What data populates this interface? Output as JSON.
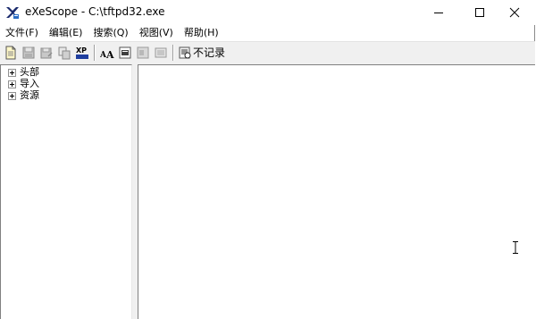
{
  "window": {
    "title": "eXeScope - C:\\tftpd32.exe"
  },
  "menu": [
    {
      "label": "文件(F)"
    },
    {
      "label": "编辑(E)"
    },
    {
      "label": "搜索(Q)"
    },
    {
      "label": "视图(V)"
    },
    {
      "label": "帮助(H)"
    }
  ],
  "toolbar": {
    "no_record_label": "不记录",
    "icons": [
      "new-file-icon",
      "save-icon",
      "save-as-icon",
      "copy-icon",
      "xp-style-icon",
      "font-icon",
      "resource-icon",
      "dialog-icon",
      "export-icon",
      "no-record-icon"
    ]
  },
  "tree": {
    "items": [
      {
        "label": "头部"
      },
      {
        "label": "导入"
      },
      {
        "label": "资源"
      }
    ]
  }
}
